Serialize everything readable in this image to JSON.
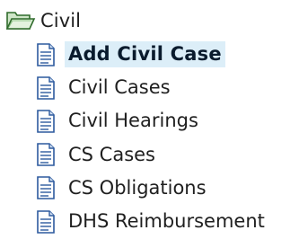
{
  "tree": {
    "root": {
      "label": "Civil",
      "icon": "open-folder-icon",
      "expanded": true
    },
    "items": [
      {
        "label": "Add Civil Case",
        "icon": "document-icon",
        "selected": true
      },
      {
        "label": "Civil Cases",
        "icon": "document-icon",
        "selected": false
      },
      {
        "label": "Civil Hearings",
        "icon": "document-icon",
        "selected": false
      },
      {
        "label": "CS Cases",
        "icon": "document-icon",
        "selected": false
      },
      {
        "label": "CS Obligations",
        "icon": "document-icon",
        "selected": false
      },
      {
        "label": "DHS Reimbursement",
        "icon": "document-icon",
        "selected": false
      }
    ]
  },
  "colors": {
    "selection_background": "#dceef8",
    "text": "#1f1f1f",
    "icon_blue": "#2d5a9e",
    "folder_green": "#3f8a3a"
  }
}
